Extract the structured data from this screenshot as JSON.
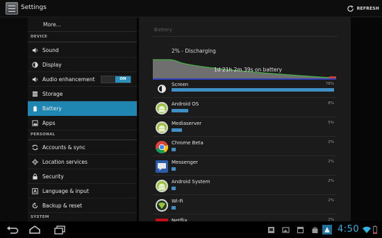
{
  "action_bar": {
    "title": "Settings",
    "refresh_label": "REFRESH"
  },
  "sidebar": {
    "more_label": "More...",
    "sections": [
      {
        "header": "DEVICE",
        "items": [
          {
            "label": "Sound",
            "icon": "speaker-icon"
          },
          {
            "label": "Display",
            "icon": "brightness-icon"
          },
          {
            "label": "Audio enhancement",
            "icon": "audio-enhancement-icon",
            "toggle": "ON"
          },
          {
            "label": "Storage",
            "icon": "storage-icon"
          },
          {
            "label": "Battery",
            "icon": "battery-icon",
            "selected": true
          },
          {
            "label": "Apps",
            "icon": "apps-icon"
          }
        ]
      },
      {
        "header": "PERSONAL",
        "items": [
          {
            "label": "Accounts & sync",
            "icon": "sync-icon"
          },
          {
            "label": "Location services",
            "icon": "location-icon"
          },
          {
            "label": "Security",
            "icon": "lock-icon"
          },
          {
            "label": "Language & input",
            "icon": "keyboard-icon"
          },
          {
            "label": "Backup & reset",
            "icon": "backup-icon"
          }
        ]
      },
      {
        "header": "SYSTEM",
        "items": []
      }
    ]
  },
  "battery": {
    "title": "Battery",
    "status": "2% - Discharging",
    "time_on_battery": "1d 21h 2m 39s on battery",
    "level_start": 1.0,
    "level_end": 0.02,
    "apps": [
      {
        "name": "Screen",
        "percent": "78%",
        "value": 78,
        "icon": "screen-brightness-icon"
      },
      {
        "name": "Android OS",
        "percent": "8%",
        "value": 8,
        "icon": "android-icon"
      },
      {
        "name": "Mediaserver",
        "percent": "5%",
        "value": 5,
        "icon": "android-icon"
      },
      {
        "name": "Chrome Beta",
        "percent": "2%",
        "value": 2,
        "icon": "chrome-icon"
      },
      {
        "name": "Messenger",
        "percent": "2%",
        "value": 2,
        "icon": "messenger-icon"
      },
      {
        "name": "Android System",
        "percent": "2%",
        "value": 2,
        "icon": "android-icon"
      },
      {
        "name": "Wi-Fi",
        "percent": "2%",
        "value": 2,
        "icon": "wifi-android-icon"
      },
      {
        "name": "Netflix",
        "percent": "2%",
        "value": 2,
        "icon": "netflix-icon"
      }
    ]
  },
  "system_bar": {
    "clock": "4:50",
    "nav": [
      "back-icon",
      "home-icon",
      "recent-apps-icon"
    ],
    "notifications": [
      "gallery-notification-icon",
      "photo-notification-icon",
      "calendar-notification-icon",
      "bag-notification-icon",
      "play-notification-icon"
    ]
  },
  "colors": {
    "accent": "#33b5e5",
    "selected": "#1f85b1",
    "bar": "#3f8fc4"
  }
}
